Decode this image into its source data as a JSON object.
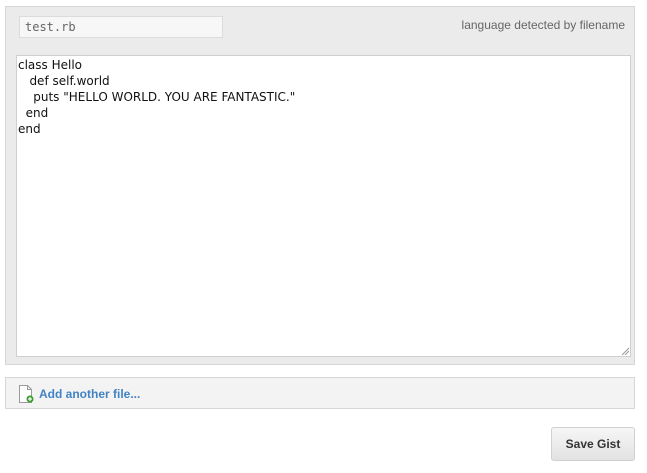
{
  "file": {
    "filename_value": "test.rb",
    "language_note": "language detected by filename",
    "code": "class Hello\n   def self.world\n    puts \"HELLO WORLD. YOU ARE FANTASTIC.\"\n  end\nend"
  },
  "add_file": {
    "icon": "new-file-icon",
    "label": "Add another file..."
  },
  "actions": {
    "save_label": "Save Gist"
  },
  "colors": {
    "link": "#4183c4",
    "panel": "#ebebeb",
    "add_icon_green": "#3a9b2e"
  }
}
